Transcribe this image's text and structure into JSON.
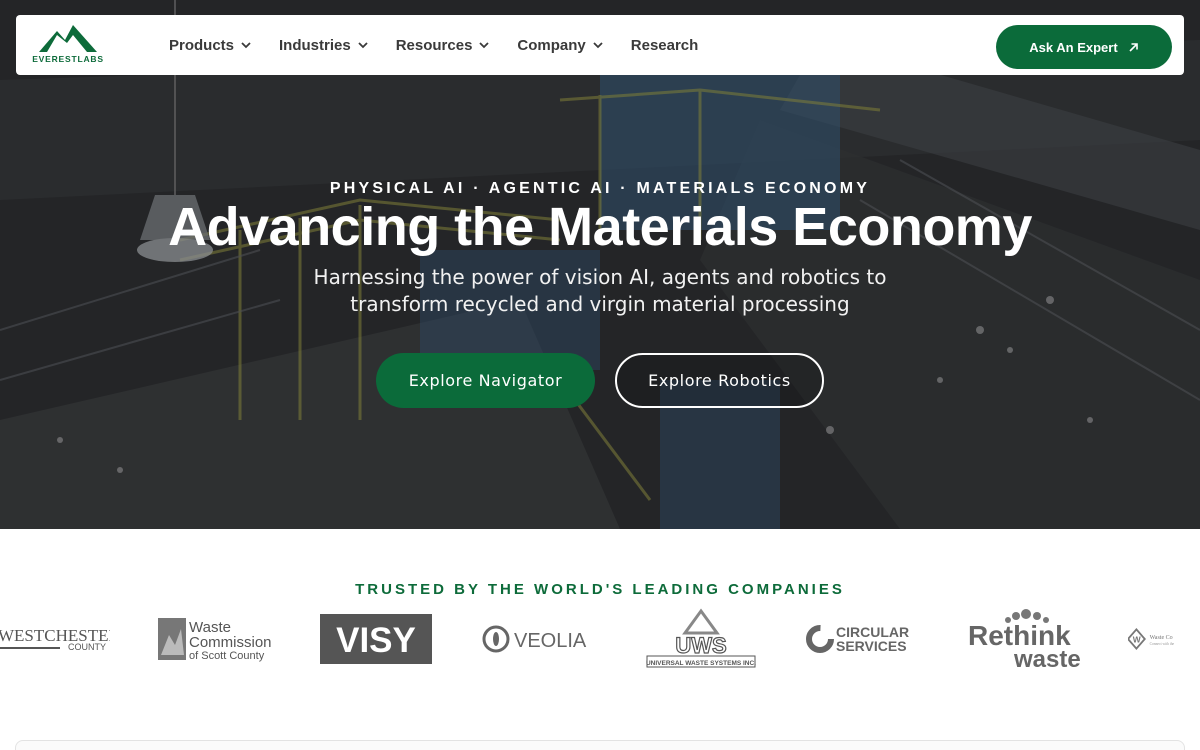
{
  "brand": {
    "name": "EVERESTLABS",
    "logo_icon": "mountain-logo-icon",
    "accent": "#0b6b3a"
  },
  "nav": {
    "items": [
      {
        "label": "Products",
        "has_dropdown": true
      },
      {
        "label": "Industries",
        "has_dropdown": true
      },
      {
        "label": "Resources",
        "has_dropdown": true
      },
      {
        "label": "Company",
        "has_dropdown": true
      },
      {
        "label": "Research",
        "has_dropdown": false
      }
    ],
    "cta_label": "Ask An Expert",
    "cta_icon": "arrow-up-right-icon"
  },
  "hero": {
    "eyebrow": "PHYSICAL AI · AGENTIC AI · MATERIALS ECONOMY",
    "headline": "Advancing the Materials Economy",
    "subhead_line1": "Harnessing the power of vision AI, agents and robotics to",
    "subhead_line2": "transform recycled and virgin material processing",
    "primary_button": "Explore Navigator",
    "secondary_button": "Explore Robotics"
  },
  "trusted": {
    "title": "TRUSTED BY THE WORLD'S LEADING COMPANIES",
    "logos": [
      {
        "name": "westchester-county",
        "line1": "WESTCHESTER",
        "line2": "COUNTY"
      },
      {
        "name": "waste-commission",
        "line1": "Waste",
        "line2": "Commission",
        "line3": "of Scott County"
      },
      {
        "name": "visy",
        "line1": "VISY"
      },
      {
        "name": "veolia",
        "line1": "VEOLIA"
      },
      {
        "name": "uws",
        "line1": "UWS",
        "line2": "UNIVERSAL WASTE SYSTEMS INC."
      },
      {
        "name": "circular-services",
        "line1": "CIRCULAR",
        "line2": "SERVICES"
      },
      {
        "name": "rethink-waste",
        "line1": "Rethink",
        "line2": "waste"
      },
      {
        "name": "waste-connections",
        "line1": "Waste Co",
        "line2": "Connect with the"
      }
    ]
  }
}
